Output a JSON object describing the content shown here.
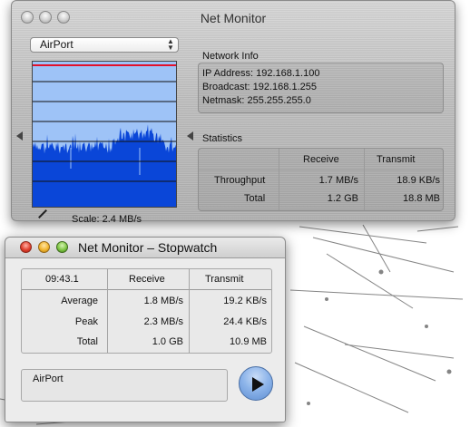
{
  "main_window": {
    "title": "Net Monitor",
    "interface_popup": {
      "selected": "AirPort"
    },
    "scale_text": "Scale: 2.4 MB/s",
    "graph": {
      "colors": {
        "background": "#9ec3f7",
        "fill": "#0a46d8",
        "line": "#111111",
        "max_line": "#e2102a"
      }
    },
    "network_info": {
      "label": "Network Info",
      "ip": "IP Address: 192.168.1.100",
      "broadcast": "Broadcast: 192.168.1.255",
      "netmask": "Netmask: 255.255.255.0"
    },
    "statistics": {
      "label": "Statistics",
      "headers": [
        "",
        "Receive",
        "Transmit"
      ],
      "rows": [
        {
          "label": "Throughput",
          "receive": "1.7 MB/s",
          "transmit": "18.9 KB/s"
        },
        {
          "label": "Total",
          "receive": "1.2 GB",
          "transmit": "18.8 MB"
        }
      ]
    }
  },
  "stopwatch_window": {
    "title": "Net Monitor – Stopwatch",
    "headers": [
      "09:43.1",
      "Receive",
      "Transmit"
    ],
    "rows": [
      {
        "label": "Average",
        "receive": "1.8 MB/s",
        "transmit": "19.2 KB/s"
      },
      {
        "label": "Peak",
        "receive": "2.3 MB/s",
        "transmit": "24.4 KB/s"
      },
      {
        "label": "Total",
        "receive": "1.0 GB",
        "transmit": "10.9 MB"
      }
    ],
    "interface": "AirPort"
  }
}
